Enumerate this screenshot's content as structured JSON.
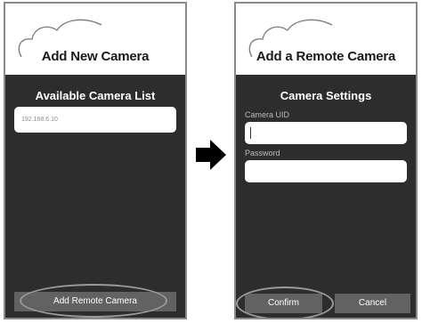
{
  "left_screen": {
    "header_title": "Add New Camera",
    "list_title": "Available Camera List",
    "camera_items": [
      "192.168.6.10"
    ],
    "remote_button": "Add Remote Camera"
  },
  "right_screen": {
    "header_title": "Add a Remote Camera",
    "settings_title": "Camera Settings",
    "uid_label": "Camera UID",
    "uid_value": "",
    "password_label": "Password",
    "password_value": "",
    "confirm_button": "Confirm",
    "cancel_button": "Cancel"
  },
  "icons": {
    "header_logo": "cloud-icon",
    "transition": "arrow-right-icon"
  },
  "colors": {
    "screen_background": "#2d2d2d",
    "header_background": "#ffffff",
    "button_background": "#626262"
  }
}
